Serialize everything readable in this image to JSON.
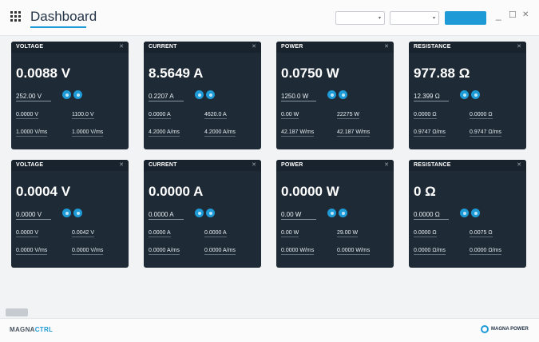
{
  "header": {
    "title": "Dashboard",
    "select1": "",
    "select2": "",
    "primary_button": "",
    "minimize": "_",
    "maximize": "☐",
    "close": "✕"
  },
  "colors": {
    "accent": "#1e9bd7",
    "card_bg": "#1e2a35"
  },
  "rows": [
    {
      "cards": [
        {
          "title": "VOLTAGE",
          "subtitle": "",
          "measurement_label": "",
          "measurement": "0.0088 V",
          "setpoint_label": "",
          "setpoint": "252.00 V",
          "f1_label": "",
          "f1": "0.0000 V",
          "f2_label": "",
          "f2": "1100.0 V",
          "f3_label": "",
          "f3": "1.0000 V/ms",
          "f4_label": "",
          "f4": "1.0000 V/ms"
        },
        {
          "title": "CURRENT",
          "subtitle": "",
          "measurement_label": "",
          "measurement": "8.5649 A",
          "setpoint_label": "",
          "setpoint": "0.2207 A",
          "f1_label": "",
          "f1": "0.0000 A",
          "f2_label": "",
          "f2": "4620.0 A",
          "f3_label": "",
          "f3": "4.2000 A/ms",
          "f4_label": "",
          "f4": "4.2000 A/ms"
        },
        {
          "title": "POWER",
          "subtitle": "",
          "measurement_label": "",
          "measurement": "0.0750 W",
          "setpoint_label": "",
          "setpoint": "1250.0 W",
          "f1_label": "",
          "f1": "0.00 W",
          "f2_label": "",
          "f2": "22275 W",
          "f3_label": "",
          "f3": "42.187 W/ms",
          "f4_label": "",
          "f4": "42.187 W/ms"
        },
        {
          "title": "RESISTANCE",
          "subtitle": "",
          "measurement_label": "",
          "measurement": "977.88 Ω",
          "setpoint_label": "",
          "setpoint": "12.399 Ω",
          "f1_label": "",
          "f1": "0.0000 Ω",
          "f2_label": "",
          "f2": "0.0000 Ω",
          "f3_label": "",
          "f3": "0.9747 Ω/ms",
          "f4_label": "",
          "f4": "0.9747 Ω/ms"
        }
      ]
    },
    {
      "cards": [
        {
          "title": "VOLTAGE",
          "subtitle": "",
          "measurement_label": "",
          "measurement": "0.0004 V",
          "setpoint_label": "",
          "setpoint": "0.0000 V",
          "f1_label": "",
          "f1": "0.0000 V",
          "f2_label": "",
          "f2": "0.0042 V",
          "f3_label": "",
          "f3": "0.0000 V/ms",
          "f4_label": "",
          "f4": "0.0000 V/ms"
        },
        {
          "title": "CURRENT",
          "subtitle": "",
          "measurement_label": "",
          "measurement": "0.0000 A",
          "setpoint_label": "",
          "setpoint": "0.0000 A",
          "f1_label": "",
          "f1": "0.0000 A",
          "f2_label": "",
          "f2": "0.0000 A",
          "f3_label": "",
          "f3": "0.0000 A/ms",
          "f4_label": "",
          "f4": "0.0000 A/ms"
        },
        {
          "title": "POWER",
          "subtitle": "",
          "measurement_label": "",
          "measurement": "0.0000 W",
          "setpoint_label": "",
          "setpoint": "0.00 W",
          "f1_label": "",
          "f1": "0.00 W",
          "f2_label": "",
          "f2": "29.00 W",
          "f3_label": "",
          "f3": "0.0000 W/ms",
          "f4_label": "",
          "f4": "0.0000 W/ms"
        },
        {
          "title": "RESISTANCE",
          "subtitle": "",
          "measurement_label": "",
          "measurement": "0 Ω",
          "setpoint_label": "",
          "setpoint": "0.0000 Ω",
          "f1_label": "",
          "f1": "0.0000 Ω",
          "f2_label": "",
          "f2": "0.0075 Ω",
          "f3_label": "",
          "f3": "0.0000 Ω/ms",
          "f4_label": "",
          "f4": "0.0000 Ω/ms"
        }
      ]
    }
  ],
  "footer": {
    "brand_prefix": "MAGNA",
    "brand_suffix": "CTRL",
    "version": "",
    "vendor": "MAGNA POWER",
    "tag": ""
  }
}
